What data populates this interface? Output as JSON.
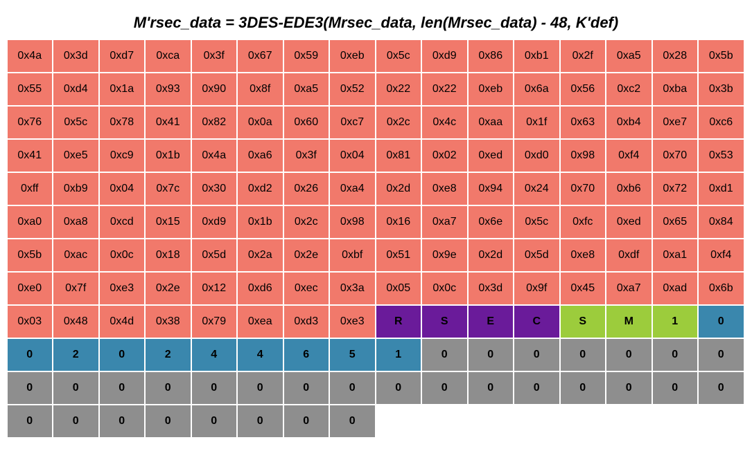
{
  "title": "M'rsec_data = 3DES-EDE3(Mrsec_data, len(Mrsec_data) - 48, K'def)",
  "cells": [
    [
      {
        "t": "hex",
        "v": "0x4a"
      },
      {
        "t": "hex",
        "v": "0x3d"
      },
      {
        "t": "hex",
        "v": "0xd7"
      },
      {
        "t": "hex",
        "v": "0xca"
      },
      {
        "t": "hex",
        "v": "0x3f"
      },
      {
        "t": "hex",
        "v": "0x67"
      },
      {
        "t": "hex",
        "v": "0x59"
      },
      {
        "t": "hex",
        "v": "0xeb"
      },
      {
        "t": "hex",
        "v": "0x5c"
      },
      {
        "t": "hex",
        "v": "0xd9"
      },
      {
        "t": "hex",
        "v": "0x86"
      },
      {
        "t": "hex",
        "v": "0xb1"
      },
      {
        "t": "hex",
        "v": "0x2f"
      },
      {
        "t": "hex",
        "v": "0xa5"
      },
      {
        "t": "hex",
        "v": "0x28"
      },
      {
        "t": "hex",
        "v": "0x5b"
      }
    ],
    [
      {
        "t": "hex",
        "v": "0x55"
      },
      {
        "t": "hex",
        "v": "0xd4"
      },
      {
        "t": "hex",
        "v": "0x1a"
      },
      {
        "t": "hex",
        "v": "0x93"
      },
      {
        "t": "hex",
        "v": "0x90"
      },
      {
        "t": "hex",
        "v": "0x8f"
      },
      {
        "t": "hex",
        "v": "0xa5"
      },
      {
        "t": "hex",
        "v": "0x52"
      },
      {
        "t": "hex",
        "v": "0x22"
      },
      {
        "t": "hex",
        "v": "0x22"
      },
      {
        "t": "hex",
        "v": "0xeb"
      },
      {
        "t": "hex",
        "v": "0x6a"
      },
      {
        "t": "hex",
        "v": "0x56"
      },
      {
        "t": "hex",
        "v": "0xc2"
      },
      {
        "t": "hex",
        "v": "0xba"
      },
      {
        "t": "hex",
        "v": "0x3b"
      }
    ],
    [
      {
        "t": "hex",
        "v": "0x76"
      },
      {
        "t": "hex",
        "v": "0x5c"
      },
      {
        "t": "hex",
        "v": "0x78"
      },
      {
        "t": "hex",
        "v": "0x41"
      },
      {
        "t": "hex",
        "v": "0x82"
      },
      {
        "t": "hex",
        "v": "0x0a"
      },
      {
        "t": "hex",
        "v": "0x60"
      },
      {
        "t": "hex",
        "v": "0xc7"
      },
      {
        "t": "hex",
        "v": "0x2c"
      },
      {
        "t": "hex",
        "v": "0x4c"
      },
      {
        "t": "hex",
        "v": "0xaa"
      },
      {
        "t": "hex",
        "v": "0x1f"
      },
      {
        "t": "hex",
        "v": "0x63"
      },
      {
        "t": "hex",
        "v": "0xb4"
      },
      {
        "t": "hex",
        "v": "0xe7"
      },
      {
        "t": "hex",
        "v": "0xc6"
      }
    ],
    [
      {
        "t": "hex",
        "v": "0x41"
      },
      {
        "t": "hex",
        "v": "0xe5"
      },
      {
        "t": "hex",
        "v": "0xc9"
      },
      {
        "t": "hex",
        "v": "0x1b"
      },
      {
        "t": "hex",
        "v": "0x4a"
      },
      {
        "t": "hex",
        "v": "0xa6"
      },
      {
        "t": "hex",
        "v": "0x3f"
      },
      {
        "t": "hex",
        "v": "0x04"
      },
      {
        "t": "hex",
        "v": "0x81"
      },
      {
        "t": "hex",
        "v": "0x02"
      },
      {
        "t": "hex",
        "v": "0xed"
      },
      {
        "t": "hex",
        "v": "0xd0"
      },
      {
        "t": "hex",
        "v": "0x98"
      },
      {
        "t": "hex",
        "v": "0xf4"
      },
      {
        "t": "hex",
        "v": "0x70"
      },
      {
        "t": "hex",
        "v": "0x53"
      }
    ],
    [
      {
        "t": "hex",
        "v": "0xff"
      },
      {
        "t": "hex",
        "v": "0xb9"
      },
      {
        "t": "hex",
        "v": "0x04"
      },
      {
        "t": "hex",
        "v": "0x7c"
      },
      {
        "t": "hex",
        "v": "0x30"
      },
      {
        "t": "hex",
        "v": "0xd2"
      },
      {
        "t": "hex",
        "v": "0x26"
      },
      {
        "t": "hex",
        "v": "0xa4"
      },
      {
        "t": "hex",
        "v": "0x2d"
      },
      {
        "t": "hex",
        "v": "0xe8"
      },
      {
        "t": "hex",
        "v": "0x94"
      },
      {
        "t": "hex",
        "v": "0x24"
      },
      {
        "t": "hex",
        "v": "0x70"
      },
      {
        "t": "hex",
        "v": "0xb6"
      },
      {
        "t": "hex",
        "v": "0x72"
      },
      {
        "t": "hex",
        "v": "0xd1"
      }
    ],
    [
      {
        "t": "hex",
        "v": "0xa0"
      },
      {
        "t": "hex",
        "v": "0xa8"
      },
      {
        "t": "hex",
        "v": "0xcd"
      },
      {
        "t": "hex",
        "v": "0x15"
      },
      {
        "t": "hex",
        "v": "0xd9"
      },
      {
        "t": "hex",
        "v": "0x1b"
      },
      {
        "t": "hex",
        "v": "0x2c"
      },
      {
        "t": "hex",
        "v": "0x98"
      },
      {
        "t": "hex",
        "v": "0x16"
      },
      {
        "t": "hex",
        "v": "0xa7"
      },
      {
        "t": "hex",
        "v": "0x6e"
      },
      {
        "t": "hex",
        "v": "0x5c"
      },
      {
        "t": "hex",
        "v": "0xfc"
      },
      {
        "t": "hex",
        "v": "0xed"
      },
      {
        "t": "hex",
        "v": "0x65"
      },
      {
        "t": "hex",
        "v": "0x84"
      }
    ],
    [
      {
        "t": "hex",
        "v": "0x5b"
      },
      {
        "t": "hex",
        "v": "0xac"
      },
      {
        "t": "hex",
        "v": "0x0c"
      },
      {
        "t": "hex",
        "v": "0x18"
      },
      {
        "t": "hex",
        "v": "0x5d"
      },
      {
        "t": "hex",
        "v": "0x2a"
      },
      {
        "t": "hex",
        "v": "0x2e"
      },
      {
        "t": "hex",
        "v": "0xbf"
      },
      {
        "t": "hex",
        "v": "0x51"
      },
      {
        "t": "hex",
        "v": "0x9e"
      },
      {
        "t": "hex",
        "v": "0x2d"
      },
      {
        "t": "hex",
        "v": "0x5d"
      },
      {
        "t": "hex",
        "v": "0xe8"
      },
      {
        "t": "hex",
        "v": "0xdf"
      },
      {
        "t": "hex",
        "v": "0xa1"
      },
      {
        "t": "hex",
        "v": "0xf4"
      }
    ],
    [
      {
        "t": "hex",
        "v": "0xe0"
      },
      {
        "t": "hex",
        "v": "0x7f"
      },
      {
        "t": "hex",
        "v": "0xe3"
      },
      {
        "t": "hex",
        "v": "0x2e"
      },
      {
        "t": "hex",
        "v": "0x12"
      },
      {
        "t": "hex",
        "v": "0xd6"
      },
      {
        "t": "hex",
        "v": "0xec"
      },
      {
        "t": "hex",
        "v": "0x3a"
      },
      {
        "t": "hex",
        "v": "0x05"
      },
      {
        "t": "hex",
        "v": "0x0c"
      },
      {
        "t": "hex",
        "v": "0x3d"
      },
      {
        "t": "hex",
        "v": "0x9f"
      },
      {
        "t": "hex",
        "v": "0x45"
      },
      {
        "t": "hex",
        "v": "0xa7"
      },
      {
        "t": "hex",
        "v": "0xad"
      },
      {
        "t": "hex",
        "v": "0x6b"
      }
    ],
    [
      {
        "t": "hex",
        "v": "0x03"
      },
      {
        "t": "hex",
        "v": "0x48"
      },
      {
        "t": "hex",
        "v": "0x4d"
      },
      {
        "t": "hex",
        "v": "0x38"
      },
      {
        "t": "hex",
        "v": "0x79"
      },
      {
        "t": "hex",
        "v": "0xea"
      },
      {
        "t": "hex",
        "v": "0xd3"
      },
      {
        "t": "hex",
        "v": "0xe3"
      },
      {
        "t": "purple",
        "v": "R"
      },
      {
        "t": "purple",
        "v": "S"
      },
      {
        "t": "purple",
        "v": "E"
      },
      {
        "t": "purple",
        "v": "C"
      },
      {
        "t": "green",
        "v": "S"
      },
      {
        "t": "green",
        "v": "M"
      },
      {
        "t": "green",
        "v": "1"
      },
      {
        "t": "blue",
        "v": "0"
      }
    ],
    [
      {
        "t": "blue",
        "v": "0"
      },
      {
        "t": "blue",
        "v": "2"
      },
      {
        "t": "blue",
        "v": "0"
      },
      {
        "t": "blue",
        "v": "2"
      },
      {
        "t": "blue",
        "v": "4"
      },
      {
        "t": "blue",
        "v": "4"
      },
      {
        "t": "blue",
        "v": "6"
      },
      {
        "t": "blue",
        "v": "5"
      },
      {
        "t": "blue",
        "v": "1"
      },
      {
        "t": "gray",
        "v": "0"
      },
      {
        "t": "gray",
        "v": "0"
      },
      {
        "t": "gray",
        "v": "0"
      },
      {
        "t": "gray",
        "v": "0"
      },
      {
        "t": "gray",
        "v": "0"
      },
      {
        "t": "gray",
        "v": "0"
      },
      {
        "t": "gray",
        "v": "0"
      }
    ],
    [
      {
        "t": "gray",
        "v": "0"
      },
      {
        "t": "gray",
        "v": "0"
      },
      {
        "t": "gray",
        "v": "0"
      },
      {
        "t": "gray",
        "v": "0"
      },
      {
        "t": "gray",
        "v": "0"
      },
      {
        "t": "gray",
        "v": "0"
      },
      {
        "t": "gray",
        "v": "0"
      },
      {
        "t": "gray",
        "v": "0"
      },
      {
        "t": "gray",
        "v": "0"
      },
      {
        "t": "gray",
        "v": "0"
      },
      {
        "t": "gray",
        "v": "0"
      },
      {
        "t": "gray",
        "v": "0"
      },
      {
        "t": "gray",
        "v": "0"
      },
      {
        "t": "gray",
        "v": "0"
      },
      {
        "t": "gray",
        "v": "0"
      },
      {
        "t": "gray",
        "v": "0"
      }
    ],
    [
      {
        "t": "gray",
        "v": "0"
      },
      {
        "t": "gray",
        "v": "0"
      },
      {
        "t": "gray",
        "v": "0"
      },
      {
        "t": "gray",
        "v": "0"
      },
      {
        "t": "gray",
        "v": "0"
      },
      {
        "t": "gray",
        "v": "0"
      },
      {
        "t": "gray",
        "v": "0"
      },
      {
        "t": "gray",
        "v": "0"
      },
      {
        "t": "blank",
        "v": ""
      },
      {
        "t": "blank",
        "v": ""
      },
      {
        "t": "blank",
        "v": ""
      },
      {
        "t": "blank",
        "v": ""
      },
      {
        "t": "blank",
        "v": ""
      },
      {
        "t": "blank",
        "v": ""
      },
      {
        "t": "blank",
        "v": ""
      },
      {
        "t": "blank",
        "v": ""
      }
    ]
  ]
}
